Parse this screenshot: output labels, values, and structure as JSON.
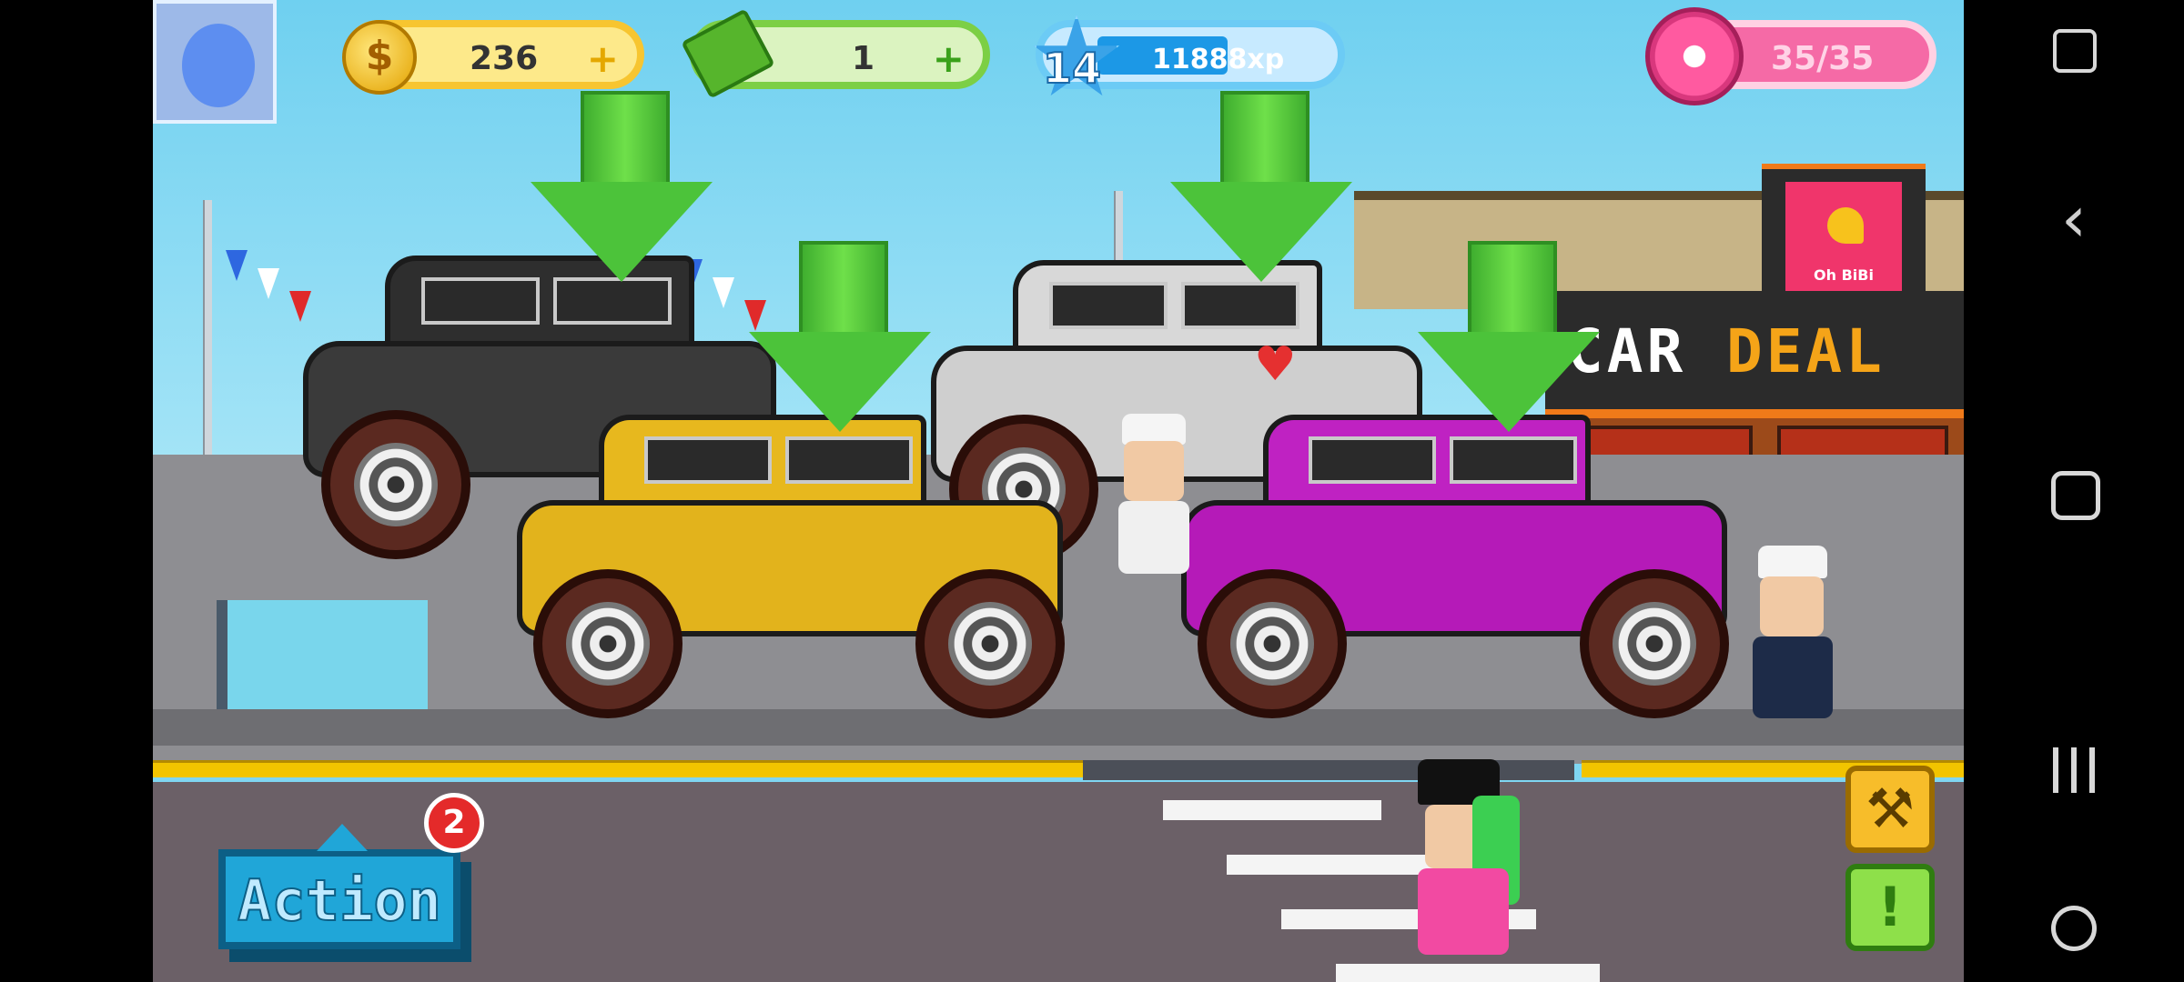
{
  "hud": {
    "coins": "236",
    "coins_plus": "+",
    "cash": "1",
    "cash_plus": "+",
    "level": "14",
    "xp": "11888xp",
    "xp_progress": 0.55,
    "donuts": "35/35",
    "coin_symbol": "$"
  },
  "store": {
    "sign_text_white": "CAR ",
    "sign_text_orange": "DEAL",
    "logo_text": "Oh BiBi"
  },
  "action": {
    "label": "Action",
    "badge_count": "2"
  },
  "side_buttons": {
    "alert_symbol": "!"
  },
  "cars": [
    {
      "color": "#3a3a3a"
    },
    {
      "color": "#cfcfcf"
    },
    {
      "color": "#e2b31c"
    },
    {
      "color": "#b51ab8"
    }
  ],
  "icons": {
    "avatar": "avatar-icon",
    "coin": "coin-icon",
    "cash": "cash-icon",
    "level": "level-star-icon",
    "donut": "donut-icon",
    "wrench": "wrench-icon",
    "alert": "alert-icon",
    "nav_tool": "screen-tool-icon",
    "nav_back": "back-icon",
    "nav_home": "home-icon",
    "nav_recents": "recents-icon",
    "nav_game": "game-tools-icon"
  }
}
